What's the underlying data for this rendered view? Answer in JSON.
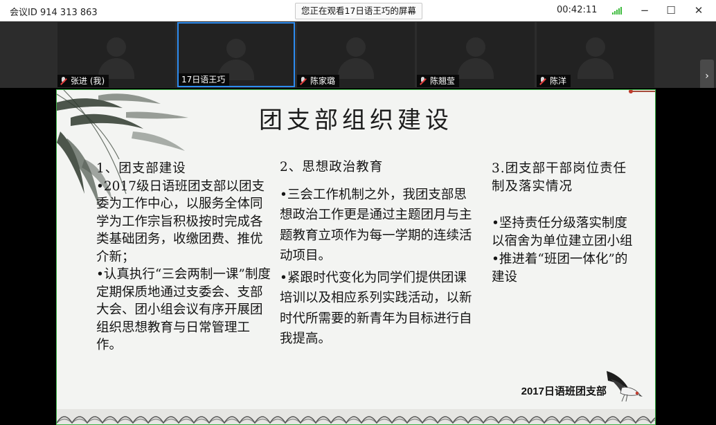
{
  "titlebar": {
    "meeting_id": "会议ID 914 313 863",
    "viewing_badge": "您正在观看17日语王巧的屏幕",
    "elapsed_time": "00:42:11",
    "icons": [
      "signal-icon",
      "minimize-icon",
      "maximize-icon",
      "close-icon"
    ],
    "glyphs": {
      "minimize": "−",
      "maximize": "☐",
      "close": "✕"
    }
  },
  "video_strip": {
    "participants": [
      {
        "name": "张进 (我)",
        "muted": true,
        "active": false
      },
      {
        "name": "17日语王巧",
        "muted": false,
        "active": true
      },
      {
        "name": "陈家璐",
        "muted": true,
        "active": false
      },
      {
        "name": "陈翘莹",
        "muted": true,
        "active": false
      },
      {
        "name": "陈洋",
        "muted": true,
        "active": false
      }
    ],
    "next_glyph": "›",
    "active_color": "#2d8cf0"
  },
  "slide": {
    "title": "团支部组织建设",
    "col1": {
      "heading": "1、团支部建设",
      "bullet1": "•2017级日语班团支部以团支委为工作中心，以服务全体同学为工作宗旨积极按时完成各类基础团务，收缴团费、推优介新；",
      "bullet2": "•认真执行“三会两制一课”制度定期保质地通过支委会、支部大会、团小组会议有序开展团组织思想教育与日常管理工作。"
    },
    "col2": {
      "heading": "2、思想政治教育",
      "bullet1": "•三会工作机制之外，我团支部思想政治工作更是通过主题团月与主题教育立项作为每一学期的连续活动项目。",
      "bullet2": "•紧跟时代变化为同学们提供团课培训以及相应系列实践活动，以新时代所需要的新青年为目标进行自我提高。"
    },
    "col3": {
      "heading": "3.团支部干部岗位责任制及落实情况",
      "bullet1": "•坚持责任分级落实制度以宿舍为单位建立团小组",
      "bullet2": "•推进着“班团一体化”的建设"
    },
    "footer": "2017日语班团支部",
    "border_color": "#3bb346",
    "background": "#f3f4f2"
  }
}
